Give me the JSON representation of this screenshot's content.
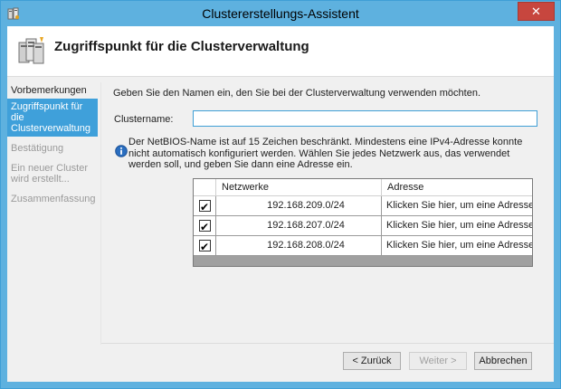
{
  "window": {
    "title": "Clustererstellungs-Assistent",
    "close_label": "✕"
  },
  "header": {
    "title": "Zugriffspunkt für die Clusterverwaltung"
  },
  "nav": {
    "items": [
      {
        "label": "Vorbemerkungen",
        "state": "normal"
      },
      {
        "label": "Zugriffspunkt für die Clusterverwaltung",
        "state": "active"
      },
      {
        "label": "Bestätigung",
        "state": "disabled"
      },
      {
        "label": "Ein neuer Cluster wird erstellt...",
        "state": "disabled"
      },
      {
        "label": "Zusammenfassung",
        "state": "disabled"
      }
    ]
  },
  "main": {
    "intro": "Geben Sie den Namen ein, den Sie bei der Clusterverwaltung verwenden möchten.",
    "cluster_name_label": "Clustername:",
    "cluster_name_value": "",
    "info_text": "Der NetBIOS-Name ist auf 15 Zeichen beschränkt.  Mindestens eine IPv4-Adresse konnte nicht automatisch konfiguriert werden. Wählen Sie jedes Netzwerk aus, das verwendet werden soll, und geben Sie dann eine Adresse ein.",
    "table": {
      "headers": [
        "",
        "Netzwerke",
        "Adresse"
      ],
      "rows": [
        {
          "checked": true,
          "network": "192.168.209.0/24",
          "address": "Klicken Sie hier, um eine Adresse e..."
        },
        {
          "checked": true,
          "network": "192.168.207.0/24",
          "address": "Klicken Sie hier, um eine Adresse e..."
        },
        {
          "checked": true,
          "network": "192.168.208.0/24",
          "address": "Klicken Sie hier, um eine Adresse e..."
        }
      ]
    }
  },
  "buttons": {
    "back": "< Zurück",
    "next": "Weiter >",
    "cancel": "Abbrechen"
  },
  "colors": {
    "titlebar": "#5eb1df",
    "nav_active": "#3fa0da",
    "close_button": "#c7463e"
  }
}
